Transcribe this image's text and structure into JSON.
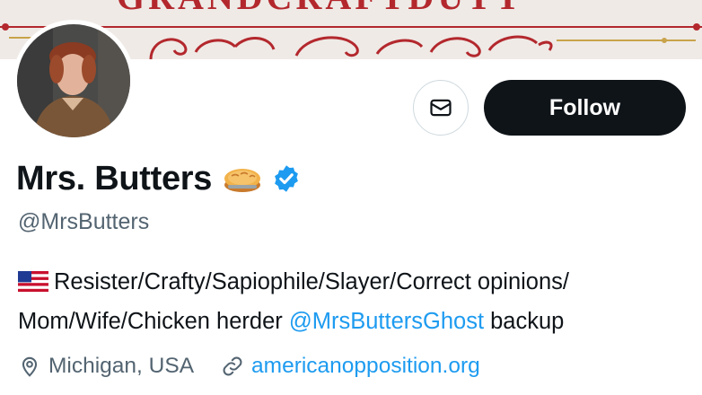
{
  "banner": {
    "lettering": "GRANDCRAFTDUTY"
  },
  "avatar": {
    "icon": "profile-photo"
  },
  "actions": {
    "message_icon": "envelope-icon",
    "follow_label": "Follow"
  },
  "profile": {
    "display_name": "Mrs. Butters",
    "name_emoji": "pie-icon",
    "verified_icon": "verified-badge-icon",
    "handle": "@MrsButters",
    "bio": {
      "flag": "us-flag-icon",
      "text_before": "Resister/Crafty/Sapiophile/Slayer/Correct opinions/ Mom/Wife/Chicken herder ",
      "mention": "@MrsButtersGhost",
      "text_after": " backup"
    },
    "location": "Michigan, USA",
    "website": "americanopposition.org"
  },
  "colors": {
    "text_primary": "#0f1419",
    "text_secondary": "#536471",
    "link": "#1d9bf0",
    "follow_bg": "#0f1419",
    "verified": "#1d9bf0",
    "banner_red": "#b3282d"
  }
}
